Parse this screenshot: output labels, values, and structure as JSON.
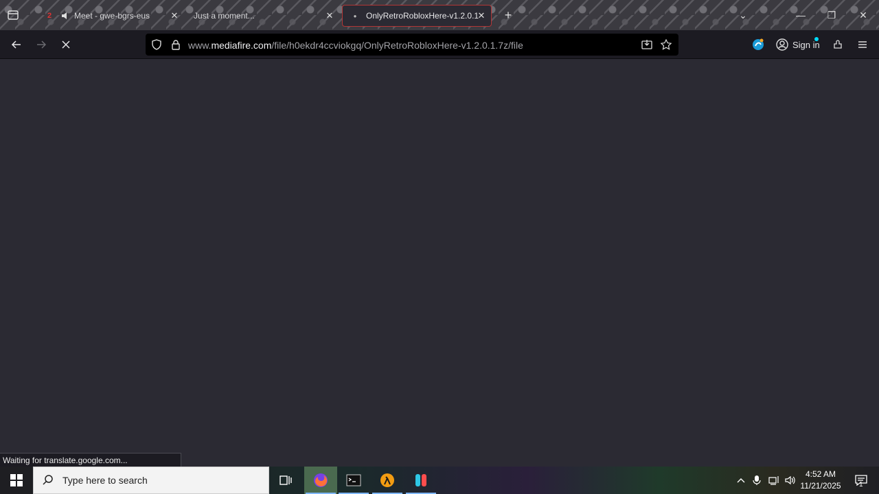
{
  "browser": {
    "tabs": [
      {
        "title": "Meet - gwe-bgrs-eus",
        "badge": "2"
      },
      {
        "title": "Just a moment..."
      },
      {
        "title": "OnlyRetroRobloxHere-v1.2.0.1"
      }
    ],
    "url": {
      "prefix": "www.",
      "domain": "mediafire.com",
      "path": "/file/h0ekdr4ccviokgq/OnlyRetroRobloxHere-v1.2.0.1.7z/file"
    },
    "signin_label": "Sign in",
    "status_text": "Waiting for translate.google.com..."
  },
  "taskbar": {
    "search_placeholder": "Type here to search",
    "time": "4:52 AM",
    "date": "11/21/2025",
    "notification_count": "1"
  },
  "colors": {
    "content_bg": "#2b2a33",
    "navbar_bg": "#1c1b22",
    "active_tab_border": "#b33636"
  }
}
